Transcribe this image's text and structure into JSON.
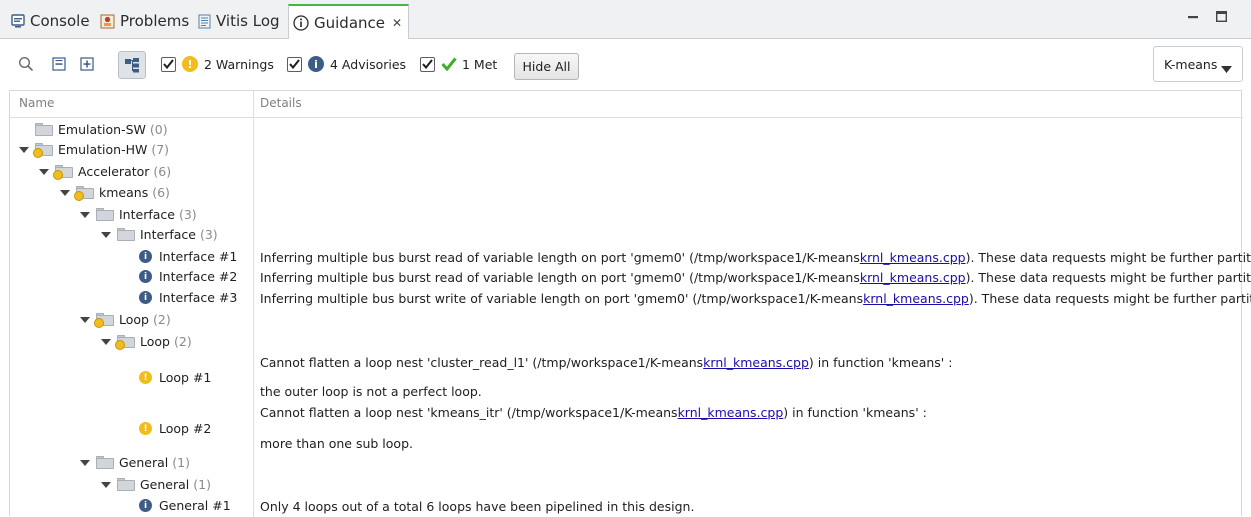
{
  "tabs": [
    {
      "label": "Console",
      "icon": "console-icon"
    },
    {
      "label": "Problems",
      "icon": "problems-icon"
    },
    {
      "label": "Vitis Log",
      "icon": "log-icon"
    },
    {
      "label": "Guidance",
      "icon": "info-icon",
      "close": "✕"
    }
  ],
  "toolbar": {
    "warnings_label": "2 Warnings",
    "advisories_label": "4 Advisories",
    "met_label": "1 Met",
    "hide_all_label": "Hide All",
    "project_select": "K-means"
  },
  "table": {
    "headers": {
      "name": "Name",
      "details": "Details"
    },
    "rows": [
      {
        "label": "Emulation-SW",
        "count": "(0)"
      },
      {
        "label": "Emulation-HW",
        "count": "(7)"
      },
      {
        "label": "Accelerator",
        "count": "(6)"
      },
      {
        "label": "kmeans",
        "count": "(6)"
      },
      {
        "label": "Interface",
        "count": "(3)"
      },
      {
        "label": "Interface",
        "count": "(3)"
      },
      {
        "label": "Interface #1"
      },
      {
        "label": "Interface #2"
      },
      {
        "label": "Interface #3"
      },
      {
        "label": "Loop",
        "count": "(2)"
      },
      {
        "label": "Loop",
        "count": "(2)"
      },
      {
        "label": "Loop #1"
      },
      {
        "label": "Loop #2"
      },
      {
        "label": "General",
        "count": "(1)"
      },
      {
        "label": "General",
        "count": "(1)"
      },
      {
        "label": "General #1"
      }
    ],
    "details": {
      "interface1": {
        "pre": "Inferring multiple bus burst read of variable length on port 'gmem0' (/tmp/workspace1/K-means",
        "link": "krnl_kmeans.cpp",
        "post": "). These data requests might be further partitioned to"
      },
      "interface2": {
        "pre": "Inferring multiple bus burst read of variable length on port 'gmem0' (/tmp/workspace1/K-means",
        "link": "krnl_kmeans.cpp",
        "post": "). These data requests might be further partitioned to"
      },
      "interface3": {
        "pre": "Inferring multiple bus burst write of variable length on port 'gmem0' (/tmp/workspace1/K-means",
        "link": "krnl_kmeans.cpp",
        "post": "). These data requests might be further partitioned to"
      },
      "loop1_a": {
        "pre": "Cannot flatten a loop nest 'cluster_read_l1' (/tmp/workspace1/K-means",
        "link": "krnl_kmeans.cpp",
        "post": ") in function 'kmeans' :"
      },
      "loop1_b": "the outer loop is not a perfect loop.",
      "loop2_a": {
        "pre": "Cannot flatten a loop nest 'kmeans_itr' (/tmp/workspace1/K-means",
        "link": "krnl_kmeans.cpp",
        "post": ") in function 'kmeans' :"
      },
      "loop2_b": "more than one sub loop.",
      "general1": "Only 4 loops out of a total 6 loops have been pipelined in this design."
    }
  },
  "colors": {
    "active_tab_accent": "#48b448",
    "warning": "#f1bd1c",
    "info": "#3d5c86",
    "met": "#3fae2a",
    "link": "#1a0dab"
  }
}
